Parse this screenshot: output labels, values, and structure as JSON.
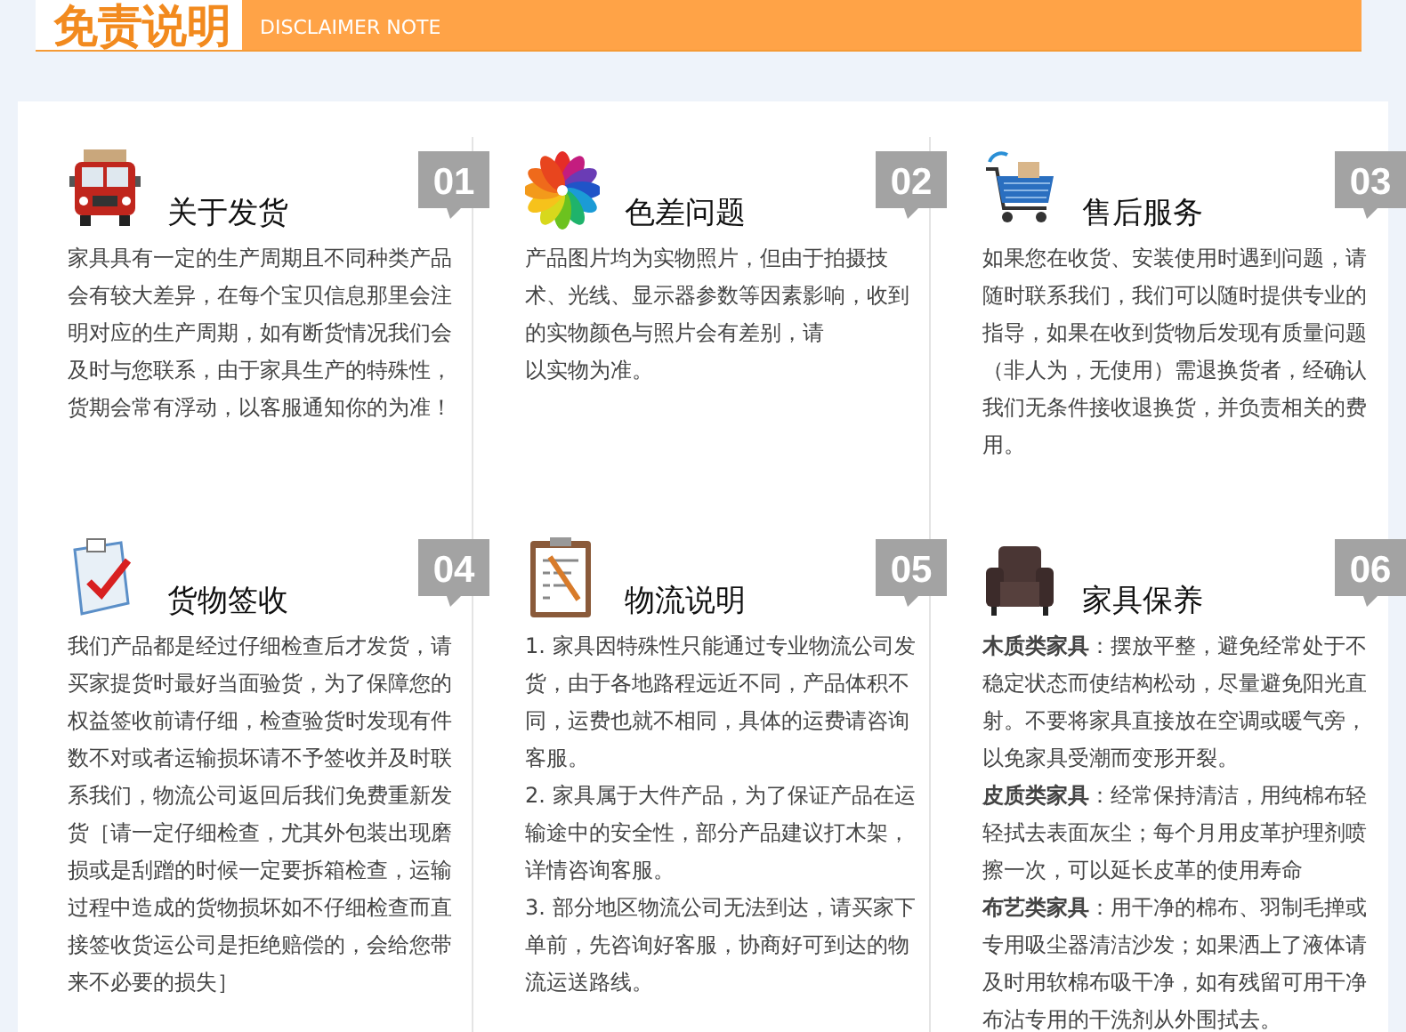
{
  "header": {
    "title": "免责说明",
    "subtitle": "DISCLAIMER NOTE"
  },
  "sections": [
    {
      "number": "01",
      "title": "关于发货",
      "paragraphs": [
        "家具具有一定的生产周期且不同种类产品会有较大差异，在每个宝贝信息那里会注明对应的生产周期，如有断货情况我们会及时与您联系，由于家具生产的特殊性，货期会常有浮动，以客服通知你的为准！"
      ]
    },
    {
      "number": "02",
      "title": "色差问题",
      "paragraphs": [
        "产品图片均为实物照片，但由于拍摄技术、光线、显示器参数等因素影响，收到的实物颜色与照片会有差别，请",
        "以实物为准。"
      ]
    },
    {
      "number": "03",
      "title": "售后服务",
      "paragraphs": [
        "如果您在收货、安装使用时遇到问题，请随时联系我们，我们可以随时提供专业的指导，如果在收到货物后发现有质量问题（非人为，无使用）需退换货者，经确认我们无条件接收退换货，并负责相关的费用。"
      ]
    },
    {
      "number": "04",
      "title": "货物签收",
      "paragraphs": [
        "我们产品都是经过仔细检查后才发货，请买家提货时最好当面验货，为了保障您的权益签收前请仔细，检查验货时发现有件数不对或者运输损坏请不予签收并及时联系我们，物流公司返回后我们免费重新发货［请一定仔细检查，尤其外包装出现磨损或是刮蹭的时候一定要拆箱检查，运输过程中造成的货物损坏如不仔细检查而直接签收货运公司是拒绝赔偿的，会给您带来不必要的损失］"
      ]
    },
    {
      "number": "05",
      "title": "物流说明",
      "paragraphs": [
        "1. 家具因特殊性只能通过专业物流公司发货，由于各地路程远近不同，产品体积不同，运费也就不相同，具体的运费请咨询客服。",
        "2. 家具属于大件产品，为了保证产品在运输途中的安全性，部分产品建议打木架，详情咨询客服。",
        "3. 部分地区物流公司无法到达，请买家下单前，先咨询好客服，协商好可到达的物流运送路线。"
      ]
    },
    {
      "number": "06",
      "title": "家具保养",
      "paragraphs": [
        "**木质类家具**：摆放平整，避免经常处于不稳定状态而使结构松动，尽量避免阳光直射。不要将家具直接放在空调或暖气旁，以免家具受潮而变形开裂。",
        "**皮质类家具**：经常保持清洁，用纯棉布轻轻拭去表面灰尘；每个月用皮革护理剂喷擦一次，可以延长皮革的使用寿命",
        "**布艺类家具**：用干净的棉布、羽制毛掸或专用吸尘器清洁沙发；如果洒上了液体请及时用软棉布吸干净，如有残留可用干净布沾专用的干洗剂从外围拭去。"
      ]
    }
  ]
}
